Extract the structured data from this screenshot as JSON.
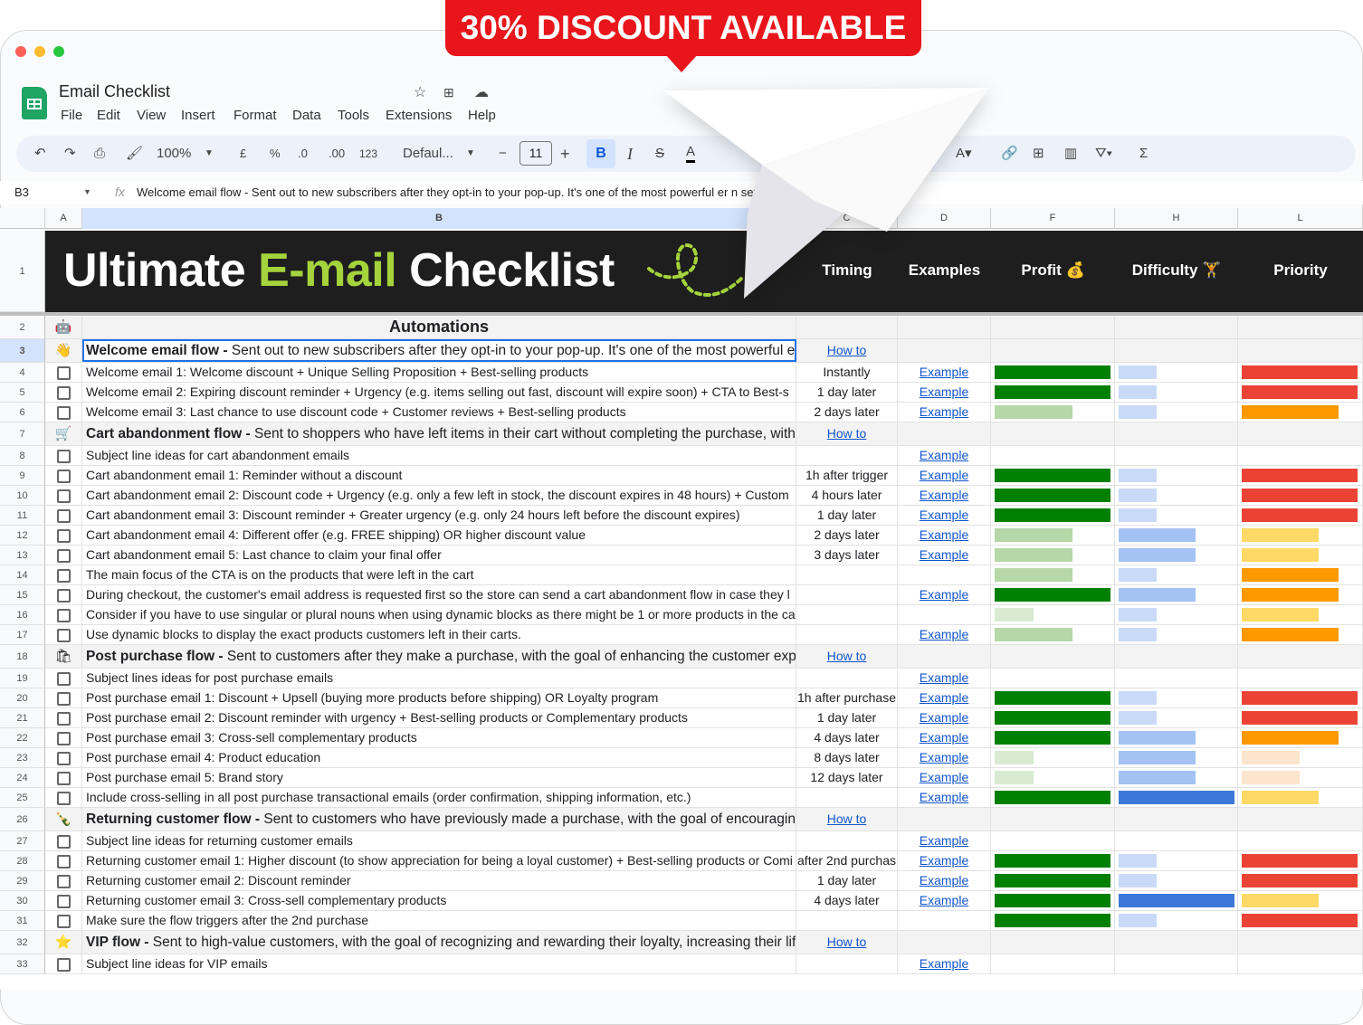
{
  "banner": "30% DISCOUNT AVAILABLE",
  "app": {
    "title": "Email Checklist",
    "menu": [
      "File",
      "Edit",
      "View",
      "Insert",
      "Format",
      "Data",
      "Tools",
      "Extensions",
      "Help"
    ]
  },
  "toolbar": {
    "zoom": "100%",
    "currency": "£",
    "percent": "%",
    "dec_minus": ".0",
    "dec_plus": ".00",
    "number_format": "123",
    "font": "Defaul...",
    "font_size": "11",
    "bold": "B",
    "italic": "I"
  },
  "formula_bar": {
    "cell_ref": "B3",
    "fx": "fx",
    "content": "Welcome email flow - Sent out to new subscribers after they opt-in to your pop-up. It's one of the most powerful er                                  n set-up."
  },
  "columns": [
    "A",
    "B",
    "C",
    "D",
    "F",
    "H",
    "L"
  ],
  "header": {
    "title_1": "Ultimate ",
    "title_2": "E-mail",
    "title_3": " Checklist",
    "timing": "Timing",
    "examples": "Examples",
    "profit": "Profit 💰",
    "difficulty": "Difficulty 🏋",
    "priority": "Priority"
  },
  "colors": {
    "profit": [
      "#d9ead3",
      "#b6d7a8",
      "#008000"
    ],
    "difficulty": [
      "#c9daf8",
      "#a4c2f4",
      "#3c78d8"
    ],
    "priority": [
      "#fce5cd",
      "#ffd966",
      "#ff9900",
      "#ea4335"
    ],
    "banner": "#e8151b",
    "title_accent": "#a4d33c"
  },
  "rows": [
    {
      "n": "2",
      "type": "head",
      "icon": "🤖",
      "text": "Automations"
    },
    {
      "n": "3",
      "type": "section",
      "icon": "👋",
      "bold": "Welcome email flow - ",
      "text": "Sent out to new subscribers after they opt-in to your pop-up. It's one of the most powerful e",
      "how": "How to",
      "selected": true
    },
    {
      "n": "4",
      "type": "item",
      "text": "Welcome email 1: Welcome discount + Unique Selling Proposition + Best-selling products",
      "timing": "Instantly",
      "link": "Example",
      "profit": 3,
      "difficulty": 1,
      "priority": 4
    },
    {
      "n": "5",
      "type": "item",
      "text": "Welcome email 2: Expiring discount reminder + Urgency (e.g. items selling out fast, discount will expire soon) + CTA to Best-s",
      "timing": "1 day later",
      "link": "Example",
      "profit": 3,
      "difficulty": 1,
      "priority": 4
    },
    {
      "n": "6",
      "type": "item",
      "text": "Welcome email 3: Last chance to use discount code + Customer reviews + Best-selling products",
      "timing": "2 days later",
      "link": "Example",
      "profit": 2,
      "difficulty": 1,
      "priority": 3
    },
    {
      "n": "7",
      "type": "section",
      "icon": "🛒",
      "bold": "Cart abandonment flow - ",
      "text": "Sent to shoppers who have left items in their cart without completing the purchase, with",
      "how": "How to"
    },
    {
      "n": "8",
      "type": "item",
      "text": "Subject line ideas for cart abandonment emails",
      "link": "Example"
    },
    {
      "n": "9",
      "type": "item",
      "text": "Cart abandonment email 1: Reminder without a discount",
      "timing": "1h after trigger",
      "link": "Example",
      "profit": 3,
      "difficulty": 1,
      "priority": 4
    },
    {
      "n": "10",
      "type": "item",
      "text": "Cart abandonment email 2: Discount code + Urgency (e.g. only a few left in stock, the discount expires in 48 hours) + Custom",
      "timing": "4 hours later",
      "link": "Example",
      "profit": 3,
      "difficulty": 1,
      "priority": 4
    },
    {
      "n": "11",
      "type": "item",
      "text": "Cart abandonment email 3: Discount reminder + Greater urgency (e.g. only 24 hours left before the discount expires)",
      "timing": "1 day later",
      "link": "Example",
      "profit": 3,
      "difficulty": 1,
      "priority": 4
    },
    {
      "n": "12",
      "type": "item",
      "text": "Cart abandonment email 4: Different offer (e.g. FREE shipping) OR higher discount value",
      "timing": "2 days later",
      "link": "Example",
      "profit": 2,
      "difficulty": 2,
      "priority": 2
    },
    {
      "n": "13",
      "type": "item",
      "text": "Cart abandonment email 5: Last chance to claim your final offer",
      "timing": "3 days later",
      "link": "Example",
      "profit": 2,
      "difficulty": 2,
      "priority": 2
    },
    {
      "n": "14",
      "type": "item",
      "text": "The main focus of the CTA is on the products that were left in the cart",
      "profit": 2,
      "difficulty": 1,
      "priority": 3
    },
    {
      "n": "15",
      "type": "item",
      "text": "During checkout, the customer's email address is requested first so the store can send a cart abandonment flow in case they l",
      "link": "Example",
      "profit": 3,
      "difficulty": 2,
      "priority": 3
    },
    {
      "n": "16",
      "type": "item",
      "text": "Consider if you have to use singular or plural nouns when using dynamic blocks as there might be 1 or more products in the ca",
      "profit": 1,
      "difficulty": 1,
      "priority": 2
    },
    {
      "n": "17",
      "type": "item",
      "text": "Use dynamic blocks to display the exact products customers left in their carts.",
      "link": "Example",
      "profit": 2,
      "difficulty": 1,
      "priority": 3
    },
    {
      "n": "18",
      "type": "section",
      "icon": "🛍",
      "bold": "Post purchase flow - ",
      "text": "Sent to customers after they make a purchase, with the goal of enhancing the customer exp",
      "how": "How to"
    },
    {
      "n": "19",
      "type": "item",
      "text": "Subject lines ideas for post purchase emails",
      "link": "Example"
    },
    {
      "n": "20",
      "type": "item",
      "text": "Post purchase email 1: Discount + Upsell (buying more products before shipping) OR Loyalty program",
      "timing": "1h after purchase",
      "link": "Example",
      "profit": 3,
      "difficulty": 1,
      "priority": 4
    },
    {
      "n": "21",
      "type": "item",
      "text": "Post purchase email 2: Discount reminder with urgency + Best-selling products or Complementary products",
      "timing": "1 day later",
      "link": "Example",
      "profit": 3,
      "difficulty": 1,
      "priority": 4
    },
    {
      "n": "22",
      "type": "item",
      "text": "Post purchase email 3: Cross-sell complementary products",
      "timing": "4 days later",
      "link": "Example",
      "profit": 3,
      "difficulty": 2,
      "priority": 3
    },
    {
      "n": "23",
      "type": "item",
      "text": "Post purchase email 4: Product education",
      "timing": "8 days later",
      "link": "Example",
      "profit": 1,
      "difficulty": 2,
      "priority": 1
    },
    {
      "n": "24",
      "type": "item",
      "text": "Post purchase email 5: Brand story",
      "timing": "12 days later",
      "link": "Example",
      "profit": 1,
      "difficulty": 2,
      "priority": 1
    },
    {
      "n": "25",
      "type": "item",
      "text": "Include cross-selling in all post purchase transactional emails (order confirmation, shipping information, etc.)",
      "link": "Example",
      "profit": 3,
      "difficulty": 3,
      "priority": 2
    },
    {
      "n": "26",
      "type": "section",
      "icon": "🍾",
      "bold": "Returning customer flow - ",
      "text": "Sent to customers who have previously made a purchase, with the goal of encouragin",
      "how": "How to"
    },
    {
      "n": "27",
      "type": "item",
      "text": "Subject line ideas for returning customer emails",
      "link": "Example"
    },
    {
      "n": "28",
      "type": "item",
      "text": "Returning customer email 1: Higher discount (to show appreciation for being a loyal customer) + Best-selling products or Comi",
      "timing": "after 2nd purchas",
      "link": "Example",
      "profit": 3,
      "difficulty": 1,
      "priority": 4
    },
    {
      "n": "29",
      "type": "item",
      "text": "Returning customer email 2: Discount reminder",
      "timing": "1 day later",
      "link": "Example",
      "profit": 3,
      "difficulty": 1,
      "priority": 4
    },
    {
      "n": "30",
      "type": "item",
      "text": "Returning customer email 3: Cross-sell complementary products",
      "timing": "4 days later",
      "link": "Example",
      "profit": 3,
      "difficulty": 3,
      "priority": 2
    },
    {
      "n": "31",
      "type": "item",
      "text": "Make sure the flow triggers after the 2nd purchase",
      "profit": 3,
      "difficulty": 1,
      "priority": 4
    },
    {
      "n": "32",
      "type": "section",
      "icon": "⭐",
      "bold": "VIP flow - ",
      "text": "Sent to high-value customers, with the goal of recognizing and rewarding their loyalty, increasing their lif",
      "how": "How to"
    },
    {
      "n": "33",
      "type": "item",
      "text": "Subject line ideas for VIP emails",
      "link": "Example"
    }
  ]
}
